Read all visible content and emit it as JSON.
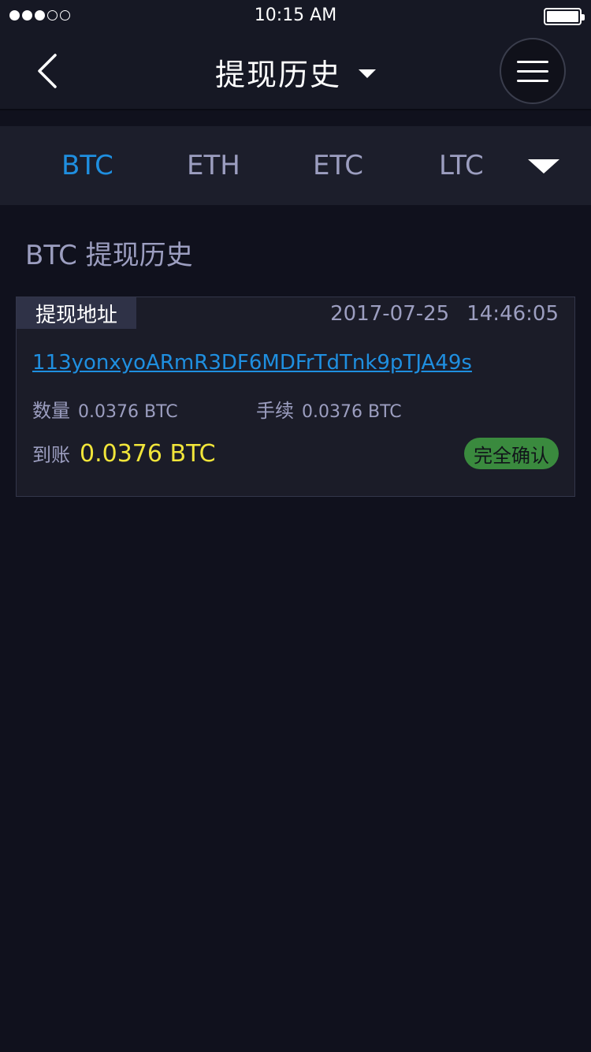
{
  "status_bar": {
    "time": "10:15 AM",
    "signal": {
      "filled": 3,
      "empty": 2
    },
    "battery_level": 1.0
  },
  "nav": {
    "title": "提现历史",
    "back_icon": "chevron-left-icon",
    "menu_icon": "hamburger-menu-icon",
    "title_dropdown_icon": "caret-down-icon"
  },
  "coin_tabs": {
    "items": [
      {
        "label": "BTC",
        "active": true
      },
      {
        "label": "ETH",
        "active": false
      },
      {
        "label": "ETC",
        "active": false
      },
      {
        "label": "LTC",
        "active": false
      }
    ],
    "more_icon": "caret-down-icon"
  },
  "section": {
    "title": "BTC 提现历史"
  },
  "records": [
    {
      "address_label": "提现地址",
      "date": "2017-07-25",
      "time": "14:46:05",
      "address": "113yonxyoARmR3DF6MDFrTdTnk9pTJA49s",
      "amount_label": "数量",
      "amount": "0.0376 BTC",
      "fee_label": "手续",
      "fee": "0.0376 BTC",
      "received_label": "到账",
      "received": "0.0376 BTC",
      "status": "完全确认"
    }
  ],
  "colors": {
    "background": "#10111d",
    "accent_blue": "#1f8fe0",
    "received_yellow": "#f1e53a",
    "status_green": "#3a8a3e",
    "muted_text": "#9c9ec0"
  }
}
